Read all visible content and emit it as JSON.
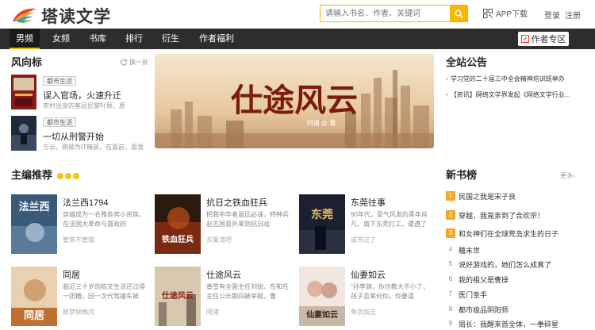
{
  "header": {
    "logo_text": "塔读文学",
    "search_placeholder": "请输入书名、作者、关键词",
    "app_download": "APP下载",
    "login": "登录",
    "register": "注册"
  },
  "nav": {
    "items": [
      "男频",
      "女频",
      "书库",
      "排行",
      "衍生",
      "作者福利"
    ],
    "author_zone": "作者专区"
  },
  "feng_xiang_biao": {
    "title": "风向标",
    "refresh": "换一批",
    "books": [
      {
        "tag": "都市生活",
        "title": "误入官场，火速升迁",
        "desc": "农村出身的基层民警叶辰，原"
      },
      {
        "tag": "都市生活",
        "title": "一切从刑警开始",
        "desc": "方云，刚被为IT精英，在面前，面发"
      }
    ]
  },
  "banner": {
    "title": "仕途风云",
    "author": "阿诸 @ 著"
  },
  "announcement": {
    "title": "全站公告",
    "items": [
      "学习党的二十届三中全会精神培训班举办",
      "【资讯】网络文学界发起《网络文学行业..."
    ]
  },
  "editor_picks": {
    "title": "主编推荐",
    "books": [
      {
        "title": "法兰西1794",
        "desc": "穿越成为一名雅各宾小资族，在法国大革命与督政府",
        "author": "管茶不管猫",
        "cover_text": "法兰西"
      },
      {
        "title": "抗日之铁血狂兵",
        "desc": "把我中华者虽远必诛，特种兵赵志国意外来到抗日战",
        "author": "东篱湾吧",
        "cover_text": "铁血狂兵"
      },
      {
        "title": "东莞往事",
        "desc": "90年代，意气风发的青年肖凡，南下东莞打工，遭遇了",
        "author": "城市过了",
        "cover_text": "东莞"
      },
      {
        "title": "同居",
        "desc": "临近三十岁的陈文生活还过得一团糟，因一次代驾撞车被",
        "author": "醉梦倾晚月",
        "cover_text": "同居"
      },
      {
        "title": "仕途风云",
        "desc": "香雪有全面主任刘锐，在和任主任公示期间被举报，曹",
        "author": "阿诸",
        "cover_text": "仕途风云"
      },
      {
        "title": "仙妻如云",
        "desc": "\"孙李渊，你也教大不小了，孩子且来何你。你要逼",
        "author": "朱衣加吉",
        "cover_text": "仙妻如云"
      }
    ]
  },
  "new_books": {
    "title": "新书榜",
    "more": "更多",
    "items": [
      {
        "num": "1",
        "title": "民国之我是宋子良"
      },
      {
        "num": "2",
        "title": "穿越，我竟亲到了合欢宗！"
      },
      {
        "num": "3",
        "title": "和女神们在全球荒岛求生的日子"
      },
      {
        "num": "4",
        "title": "瞌末世"
      },
      {
        "num": "5",
        "title": "说好游戏的，她们怎么成真了"
      },
      {
        "num": "6",
        "title": "我的祖父是曹操"
      },
      {
        "num": "7",
        "title": "医门圣手"
      },
      {
        "num": "8",
        "title": "都市极品阴阳师"
      },
      {
        "num": "9",
        "title": "局长：我醒来首全体，一拳碎星"
      }
    ]
  },
  "colors": {
    "accent": "#f5b800",
    "nav_bg": "#2d2d2d"
  }
}
